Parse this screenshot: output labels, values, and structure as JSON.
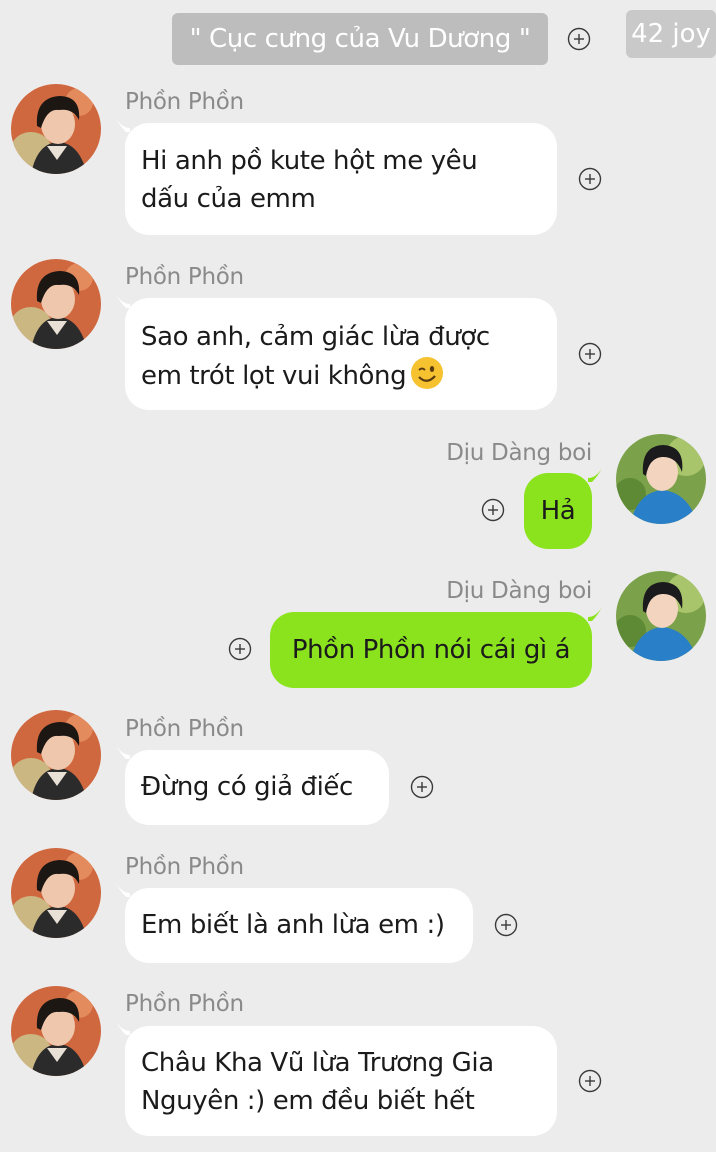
{
  "header": {
    "title": "\" Cục cưng của Vu Dương \"",
    "watermark": "42 joy"
  },
  "messages": [
    {
      "sender": "Phồn Phồn",
      "side": "left",
      "lines": [
        "Hi anh pồ kute hột me yêu",
        "dấu của emm"
      ]
    },
    {
      "sender": "Phồn Phồn",
      "side": "left",
      "lines": [
        "Sao anh, cảm giác lừa được",
        "em trót lọt vui không"
      ],
      "emoji": "wink-emoji"
    },
    {
      "sender": "Dịu Dàng boi",
      "side": "right",
      "lines": [
        "Hả"
      ]
    },
    {
      "sender": "Dịu Dàng boi",
      "side": "right",
      "lines": [
        "Phồn Phồn nói cái gì á"
      ]
    },
    {
      "sender": "Phồn Phồn",
      "side": "left",
      "lines": [
        "Đừng có giả điếc"
      ]
    },
    {
      "sender": "Phồn Phồn",
      "side": "left",
      "lines": [
        "Em biết là anh lừa em :)"
      ]
    },
    {
      "sender": "Phồn Phồn",
      "side": "left",
      "lines": [
        "Châu Kha Vũ lừa Trương Gia",
        "Nguyên :) em đều biết hết"
      ]
    }
  ],
  "colors": {
    "background": "#ececec",
    "incoming_bubble": "#ffffff",
    "outgoing_bubble": "#8be31e",
    "name_text": "#8a8a8a",
    "title_pill": "#bdbdbd"
  },
  "icons": {
    "add": "plus-circle-icon",
    "avatar_left": "avatar-phon-phon",
    "avatar_right": "avatar-diu-dang-boi"
  }
}
